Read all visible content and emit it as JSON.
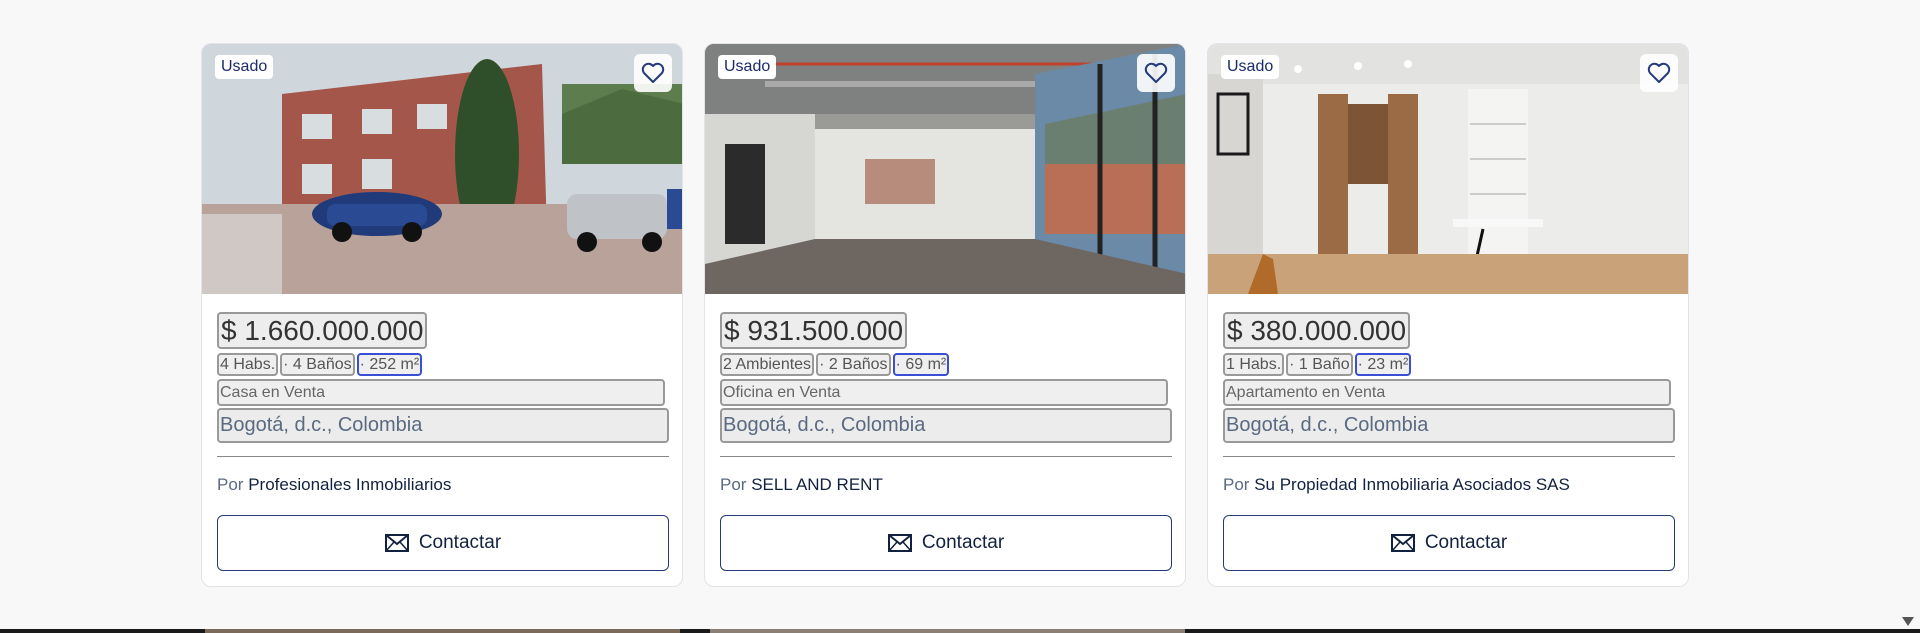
{
  "listings": [
    {
      "badge": "Usado",
      "price": "$ 1.660.000.000",
      "features": [
        "4 Habs.",
        "· 4 Baños",
        "· 252 m²"
      ],
      "property_type": "Casa en Venta",
      "location": "Bogotá, d.c., Colombia",
      "by_prefix": "Por",
      "agency": "Profesionales Inmobiliarios",
      "contact_label": "Contactar",
      "photo_icon": "house-exterior-photo"
    },
    {
      "badge": "Usado",
      "price": "$ 931.500.000",
      "features": [
        "2 Ambientes",
        "· 2 Baños",
        "· 69 m²"
      ],
      "property_type": "Oficina en Venta",
      "location": "Bogotá, d.c., Colombia",
      "by_prefix": "Por",
      "agency": "SELL AND RENT",
      "contact_label": "Contactar",
      "photo_icon": "office-interior-photo"
    },
    {
      "badge": "Usado",
      "price": "$ 380.000.000",
      "features": [
        "1 Habs.",
        "· 1 Baño",
        "· 23 m²"
      ],
      "property_type": "Apartamento en Venta",
      "location": "Bogotá, d.c., Colombia",
      "by_prefix": "Por",
      "agency": "Su Propiedad Inmobiliaria Asociados SAS",
      "contact_label": "Contactar",
      "photo_icon": "apartment-interior-photo"
    }
  ],
  "colors": {
    "accent": "#253a78",
    "area_border": "#3a4fd6",
    "background": "#f8f8f8"
  }
}
